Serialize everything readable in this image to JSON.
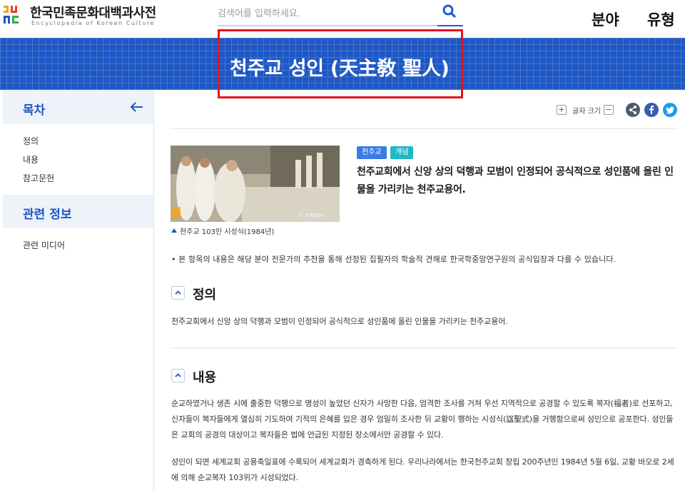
{
  "header": {
    "logo_title": "한국민족문화대백과사전",
    "logo_subtitle": "Encyclopedia of Korean Culture",
    "search_placeholder": "검색어를 입력하세요.",
    "nav": [
      "분야",
      "유형"
    ]
  },
  "banner": {
    "title": "천주교 성인 (天主敎 聖人)"
  },
  "sidebar": {
    "toc_title": "목차",
    "toc_items": [
      "정의",
      "내용",
      "참고문헌"
    ],
    "related_title": "관련 정보",
    "related_items": [
      "관련 미디어"
    ]
  },
  "tools": {
    "font_size_label": "글자 크기",
    "plus": "+",
    "minus": "−"
  },
  "article": {
    "photo_watermark": "ⓒ 조선일보사",
    "caption": "천주교 103인 시성식(1984년)",
    "tags": [
      "천주교",
      "개념"
    ],
    "summary": "천주교회에서 신앙 상의 덕행과 모범이 인정되어 공식적으로 성인품에 올린 인물을 가리키는 천주교용어.",
    "notice": "• 본 항목의 내용은 해당 분야 전문가의 추천을 통해 선정된 집필자의 학술적 견해로 한국학중앙연구원의 공식입장과 다를 수 있습니다.",
    "sections": [
      {
        "title": "정의",
        "paragraphs": [
          "천주교회에서 신앙 상의 덕행과 모범이 인정되어 공식적으로 성인품에 올린 인물을 가리키는 천주교용어."
        ]
      },
      {
        "title": "내용",
        "paragraphs": [
          "순교하였거나 생존 시에 출중한 덕행으로 명성이 높았던 신자가 사망한 다음, 엄격한 조사를 거쳐 우선 지역적으로 공경할 수 있도록 복자(福者)로 선포하고, 신자들이 복자들에게 열심히 기도하여 기적의 은혜를 입은 경우 엄밀히 조사한 뒤 교황이 행하는 시성식(諡聖式)을 거행함으로써 성인으로 공포한다. 성인들은 교회의 공경의 대상이고 복자들은 법에 언급된 지정된 장소에서만 공경할 수 있다.",
          "성인이 되면 세계교회 공용축일표에 수록되어 세계교회가 경축하게 된다. 우리나라에서는 한국천주교회 창립 200주년인 1984년 5월 6일, 교황 바오로 2세에 의해 순교복자 103위가 시성되었다."
        ]
      }
    ]
  },
  "colors": {
    "brand_blue": "#1e57c5",
    "highlight_red": "#e3121f",
    "tag_blue": "#3a7be8",
    "tag_teal": "#1fb8c9"
  }
}
